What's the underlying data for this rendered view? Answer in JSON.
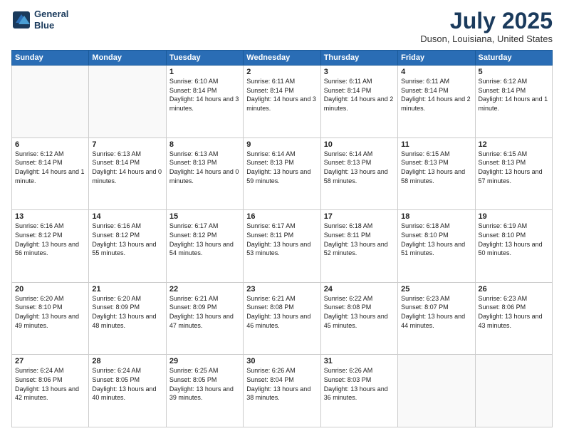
{
  "header": {
    "logo_line1": "General",
    "logo_line2": "Blue",
    "title": "July 2025",
    "location": "Duson, Louisiana, United States"
  },
  "days_of_week": [
    "Sunday",
    "Monday",
    "Tuesday",
    "Wednesday",
    "Thursday",
    "Friday",
    "Saturday"
  ],
  "weeks": [
    [
      {
        "day": "",
        "info": ""
      },
      {
        "day": "",
        "info": ""
      },
      {
        "day": "1",
        "info": "Sunrise: 6:10 AM\nSunset: 8:14 PM\nDaylight: 14 hours\nand 3 minutes."
      },
      {
        "day": "2",
        "info": "Sunrise: 6:11 AM\nSunset: 8:14 PM\nDaylight: 14 hours\nand 3 minutes."
      },
      {
        "day": "3",
        "info": "Sunrise: 6:11 AM\nSunset: 8:14 PM\nDaylight: 14 hours\nand 2 minutes."
      },
      {
        "day": "4",
        "info": "Sunrise: 6:11 AM\nSunset: 8:14 PM\nDaylight: 14 hours\nand 2 minutes."
      },
      {
        "day": "5",
        "info": "Sunrise: 6:12 AM\nSunset: 8:14 PM\nDaylight: 14 hours\nand 1 minute."
      }
    ],
    [
      {
        "day": "6",
        "info": "Sunrise: 6:12 AM\nSunset: 8:14 PM\nDaylight: 14 hours\nand 1 minute."
      },
      {
        "day": "7",
        "info": "Sunrise: 6:13 AM\nSunset: 8:14 PM\nDaylight: 14 hours\nand 0 minutes."
      },
      {
        "day": "8",
        "info": "Sunrise: 6:13 AM\nSunset: 8:13 PM\nDaylight: 14 hours\nand 0 minutes."
      },
      {
        "day": "9",
        "info": "Sunrise: 6:14 AM\nSunset: 8:13 PM\nDaylight: 13 hours\nand 59 minutes."
      },
      {
        "day": "10",
        "info": "Sunrise: 6:14 AM\nSunset: 8:13 PM\nDaylight: 13 hours\nand 58 minutes."
      },
      {
        "day": "11",
        "info": "Sunrise: 6:15 AM\nSunset: 8:13 PM\nDaylight: 13 hours\nand 58 minutes."
      },
      {
        "day": "12",
        "info": "Sunrise: 6:15 AM\nSunset: 8:13 PM\nDaylight: 13 hours\nand 57 minutes."
      }
    ],
    [
      {
        "day": "13",
        "info": "Sunrise: 6:16 AM\nSunset: 8:12 PM\nDaylight: 13 hours\nand 56 minutes."
      },
      {
        "day": "14",
        "info": "Sunrise: 6:16 AM\nSunset: 8:12 PM\nDaylight: 13 hours\nand 55 minutes."
      },
      {
        "day": "15",
        "info": "Sunrise: 6:17 AM\nSunset: 8:12 PM\nDaylight: 13 hours\nand 54 minutes."
      },
      {
        "day": "16",
        "info": "Sunrise: 6:17 AM\nSunset: 8:11 PM\nDaylight: 13 hours\nand 53 minutes."
      },
      {
        "day": "17",
        "info": "Sunrise: 6:18 AM\nSunset: 8:11 PM\nDaylight: 13 hours\nand 52 minutes."
      },
      {
        "day": "18",
        "info": "Sunrise: 6:18 AM\nSunset: 8:10 PM\nDaylight: 13 hours\nand 51 minutes."
      },
      {
        "day": "19",
        "info": "Sunrise: 6:19 AM\nSunset: 8:10 PM\nDaylight: 13 hours\nand 50 minutes."
      }
    ],
    [
      {
        "day": "20",
        "info": "Sunrise: 6:20 AM\nSunset: 8:10 PM\nDaylight: 13 hours\nand 49 minutes."
      },
      {
        "day": "21",
        "info": "Sunrise: 6:20 AM\nSunset: 8:09 PM\nDaylight: 13 hours\nand 48 minutes."
      },
      {
        "day": "22",
        "info": "Sunrise: 6:21 AM\nSunset: 8:09 PM\nDaylight: 13 hours\nand 47 minutes."
      },
      {
        "day": "23",
        "info": "Sunrise: 6:21 AM\nSunset: 8:08 PM\nDaylight: 13 hours\nand 46 minutes."
      },
      {
        "day": "24",
        "info": "Sunrise: 6:22 AM\nSunset: 8:08 PM\nDaylight: 13 hours\nand 45 minutes."
      },
      {
        "day": "25",
        "info": "Sunrise: 6:23 AM\nSunset: 8:07 PM\nDaylight: 13 hours\nand 44 minutes."
      },
      {
        "day": "26",
        "info": "Sunrise: 6:23 AM\nSunset: 8:06 PM\nDaylight: 13 hours\nand 43 minutes."
      }
    ],
    [
      {
        "day": "27",
        "info": "Sunrise: 6:24 AM\nSunset: 8:06 PM\nDaylight: 13 hours\nand 42 minutes."
      },
      {
        "day": "28",
        "info": "Sunrise: 6:24 AM\nSunset: 8:05 PM\nDaylight: 13 hours\nand 40 minutes."
      },
      {
        "day": "29",
        "info": "Sunrise: 6:25 AM\nSunset: 8:05 PM\nDaylight: 13 hours\nand 39 minutes."
      },
      {
        "day": "30",
        "info": "Sunrise: 6:26 AM\nSunset: 8:04 PM\nDaylight: 13 hours\nand 38 minutes."
      },
      {
        "day": "31",
        "info": "Sunrise: 6:26 AM\nSunset: 8:03 PM\nDaylight: 13 hours\nand 36 minutes."
      },
      {
        "day": "",
        "info": ""
      },
      {
        "day": "",
        "info": ""
      }
    ]
  ]
}
